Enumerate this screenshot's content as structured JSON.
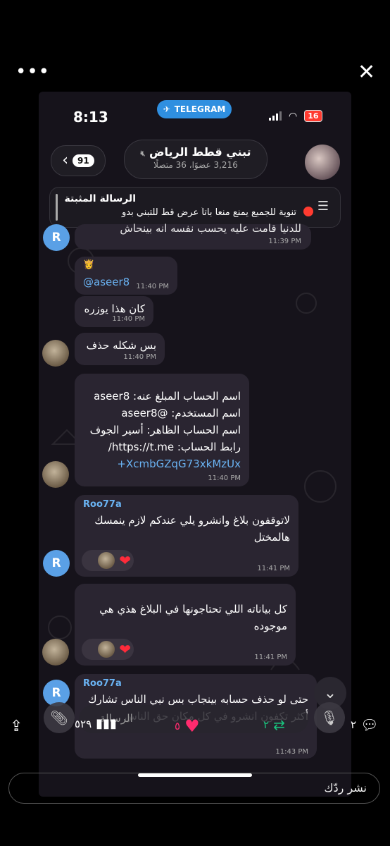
{
  "overlay": {
    "more_label": "•••",
    "close_label": "✕"
  },
  "status": {
    "time": "8:13",
    "telegram_label": "TELEGRAM",
    "battery": "16"
  },
  "chat": {
    "back_count": "91",
    "title": "تبني قطط الرياض",
    "subtitle": "3,216 عضوًا، 36 متصلًا"
  },
  "pinned": {
    "label": "الرسالة المثبتة",
    "text": "تنوية للجميع يمنع منعا باتاً عرض قط للتبني بدو"
  },
  "messages": [
    {
      "text": "للدنيا قامت عليه يحسب نفسه انه بينحاش",
      "time": "11:39 PM"
    },
    {
      "text": "@aseer8",
      "emoji": "👸",
      "time": "11:40 PM"
    },
    {
      "text": "كان هذا يوزره",
      "time": "11:40 PM"
    },
    {
      "text": "بس شكله حذف",
      "time": "11:40 PM"
    },
    {
      "lines": [
        "اسم الحساب المبلغ عنه: aseer8",
        "اسم المستخدم: @aseer8",
        "اسم الحساب الظاهر: أسير الجوف",
        "رابط الحساب: https://t.me/",
        "+XcmbGZqG73xkMzUx"
      ],
      "time": "11:40 PM"
    },
    {
      "sender": "Roo77a",
      "text": "لاتوقفون بلاغ وانشرو يلي عندكم لازم ينمسك هالمختل",
      "time": "11:41 PM",
      "reaction": "❤"
    },
    {
      "text": "كل بياناته اللي تحتاجونها في البلاغ هذي هي موجوده",
      "time": "11:41 PM",
      "reaction": "❤"
    },
    {
      "sender": "Roo77a",
      "text": "حتى لو حذف حسابه بينجاب بس نبي الناس تشارك أكثر تكفون انشرو في كل مكان حق الناس",
      "time": "11:43 PM"
    }
  ],
  "avatar_letter": "R",
  "input": {
    "placeholder": "الرسالة"
  },
  "actions": {
    "comments": "٢",
    "reposts": "٢",
    "likes": "٥",
    "views": "٥٢٩"
  },
  "reply_placeholder": "نشر ردّك",
  "colors": {
    "accent": "#6ab3f3",
    "bubble": "#2a2531",
    "like": "#ff2b6e",
    "repost": "#19c37d"
  }
}
